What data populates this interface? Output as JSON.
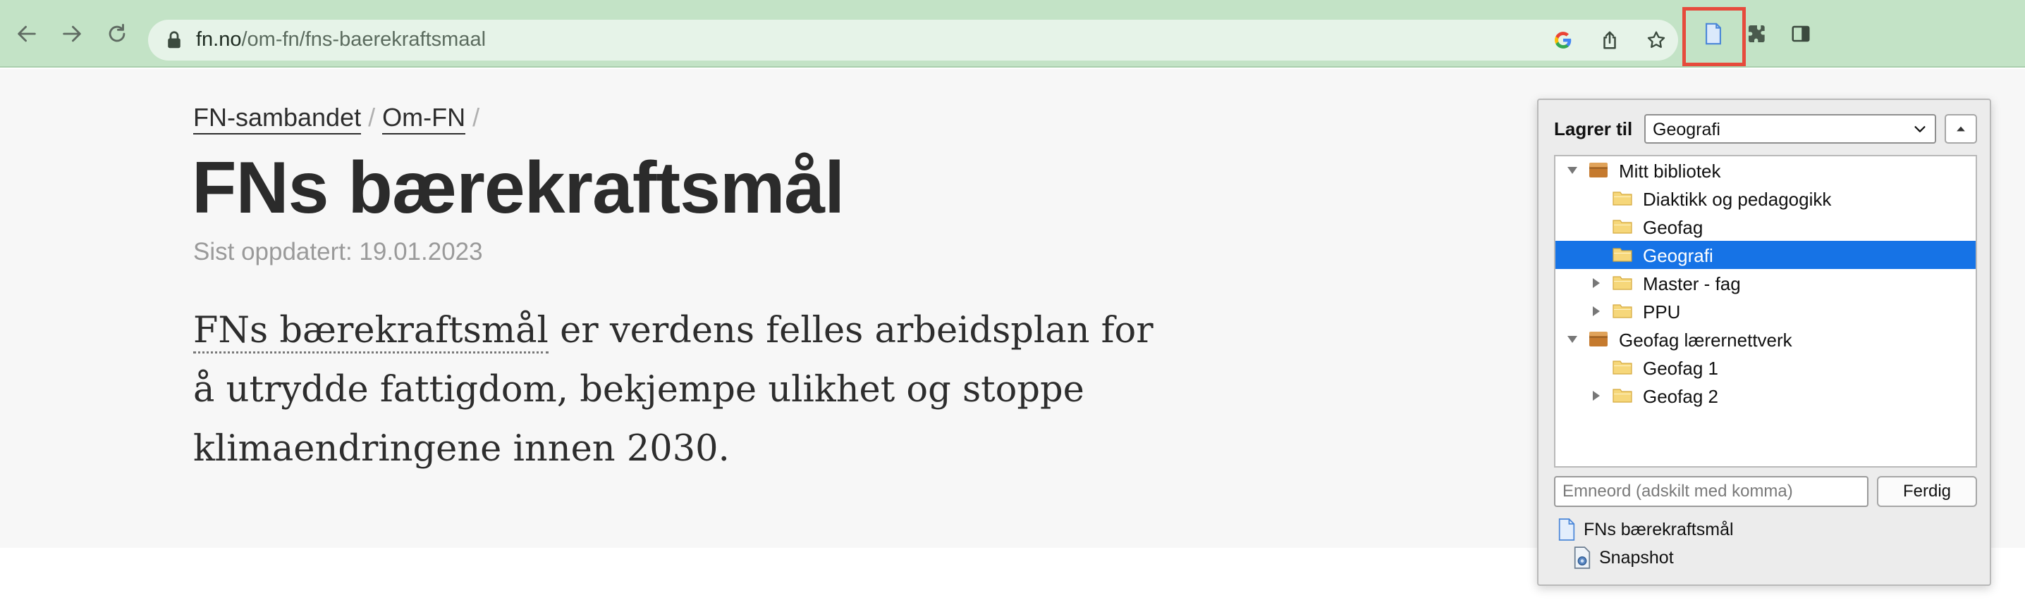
{
  "browser": {
    "url_host": "fn.no",
    "url_path": "/om-fn/fns-baerekraftsmaal",
    "icons": [
      "back-icon",
      "forward-icon",
      "reload-icon",
      "lock-icon",
      "google-icon",
      "share-icon",
      "bookmark-star-icon",
      "zotero-save-icon",
      "extensions-icon",
      "side-panel-icon"
    ],
    "highlight_color": "#e64b3c"
  },
  "page": {
    "breadcrumb": [
      "FN-sambandet",
      "Om-FN"
    ],
    "breadcrumb_separator": "/",
    "title": "FNs bærekraftsmål",
    "updated": "Sist oppdatert: 19.01.2023",
    "lead_link": "FNs bærekraftsmål",
    "lead_rest": " er verdens felles arbeidsplan for å utrydde fattigdom, bekjempe ulikhet og stoppe klimaendringene innen 2030."
  },
  "zotero": {
    "save_to_label": "Lagrer til",
    "selected_collection": "Geografi",
    "tree": [
      {
        "label": "Mitt bibliotek",
        "type": "library",
        "expanded": true,
        "level": 0
      },
      {
        "label": "Diaktikk og pedagogikk",
        "type": "folder",
        "level": 1
      },
      {
        "label": "Geofag",
        "type": "folder",
        "level": 1
      },
      {
        "label": "Geografi",
        "type": "folder",
        "level": 1,
        "selected": true
      },
      {
        "label": "Master - fag",
        "type": "folder",
        "level": 1,
        "collapsed": true
      },
      {
        "label": "PPU",
        "type": "folder",
        "level": 1,
        "collapsed": true
      },
      {
        "label": "Geofag lærernettverk",
        "type": "library",
        "expanded": true,
        "level": 0
      },
      {
        "label": "Geofag 1",
        "type": "folder",
        "level": 1
      },
      {
        "label": "Geofag 2",
        "type": "folder",
        "level": 1,
        "collapsed": true
      }
    ],
    "tags_placeholder": "Emneord (adskilt med komma)",
    "done_label": "Ferdig",
    "item_title": "FNs bærekraftsmål",
    "attachment_label": "Snapshot",
    "selection_color": "#1673e6"
  }
}
